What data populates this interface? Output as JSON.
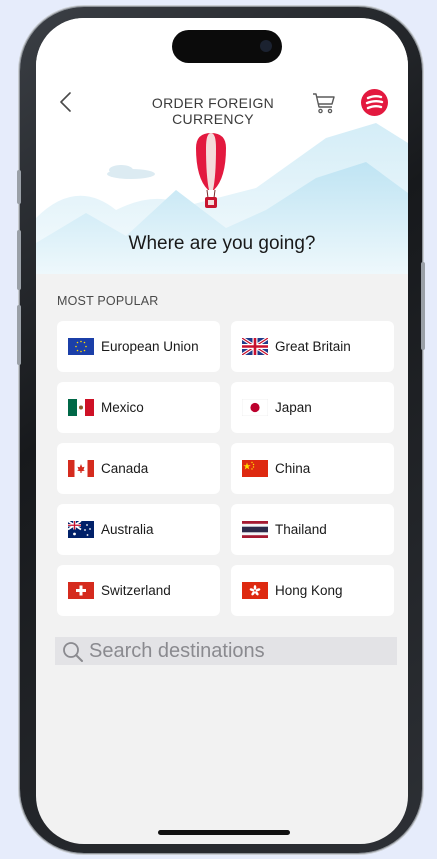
{
  "header": {
    "title": "ORDER FOREIGN CURRENCY",
    "back_icon": "chevron-left-icon",
    "cart_icon": "shopping-cart-icon",
    "logo_icon": "brand-logo-icon"
  },
  "hero": {
    "heading": "Where are you going?",
    "illustration": "hot-air-balloon-over-mountains"
  },
  "popular": {
    "label": "MOST POPULAR",
    "items": [
      {
        "name": "European Union",
        "flag": "eu"
      },
      {
        "name": "Great Britain",
        "flag": "gb"
      },
      {
        "name": "Mexico",
        "flag": "mx"
      },
      {
        "name": "Japan",
        "flag": "jp"
      },
      {
        "name": "Canada",
        "flag": "ca"
      },
      {
        "name": "China",
        "flag": "cn"
      },
      {
        "name": "Australia",
        "flag": "au"
      },
      {
        "name": "Thailand",
        "flag": "th"
      },
      {
        "name": "Switzerland",
        "flag": "ch"
      },
      {
        "name": "Hong Kong",
        "flag": "hk"
      }
    ]
  },
  "search": {
    "placeholder": "Search destinations",
    "value": "",
    "icon": "search-icon"
  },
  "colors": {
    "brand": "#e3193f",
    "page_bg": "#f2f2f2",
    "tile_bg": "#ffffff",
    "sky_blue": "#c7e7f3"
  }
}
